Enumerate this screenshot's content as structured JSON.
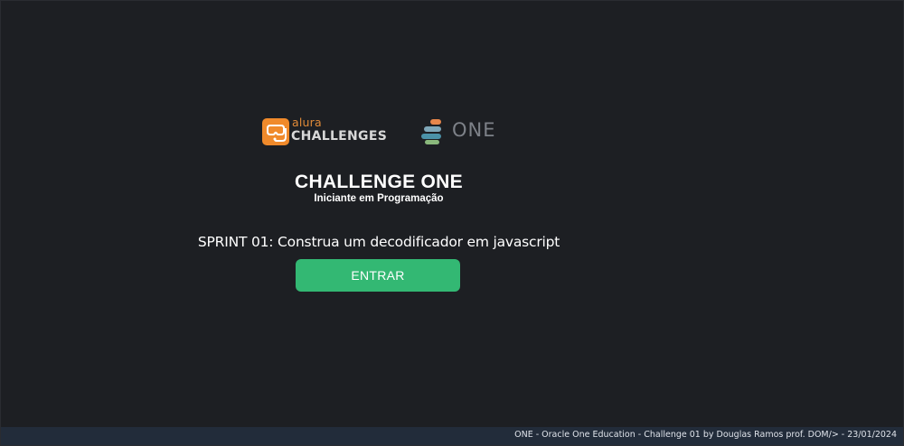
{
  "logos": {
    "alura_small": "alura",
    "alura_big": "CHALLENGES",
    "one": "ONE",
    "alura_icon": "snorkel-mask-icon",
    "one_icon": "stacked-bars-icon"
  },
  "hero": {
    "title": "CHALLENGE ONE",
    "subtitle": "Iniciante em Programação",
    "sprint": "SPRINT 01: Construa um decodificador em javascript"
  },
  "actions": {
    "enter_label": "ENTRAR"
  },
  "footer": {
    "text": "ONE - Oracle One Education - Challenge 01 by Douglas Ramos prof. DOM/> - 23/01/2024"
  },
  "colors": {
    "background": "#1d1f23",
    "accent_button": "#33b873",
    "alura_orange": "#f08a2b",
    "footer_bg": "#222c3a"
  }
}
